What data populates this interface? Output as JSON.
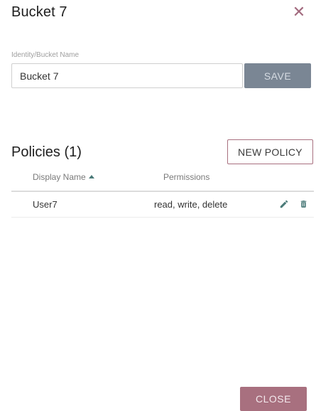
{
  "dialog": {
    "title": "Bucket 7",
    "close_icon": "close-icon",
    "close_glyph": "✕"
  },
  "form": {
    "label": "Identity/Bucket Name",
    "name_value": "Bucket 7",
    "save_label": "SAVE"
  },
  "policies": {
    "title": "Policies (1)",
    "new_policy_label": "NEW POLICY",
    "columns": [
      "Display Name",
      "Permissions"
    ],
    "sort_icon": "sort-ascending-icon",
    "rows": [
      {
        "display_name": "User7",
        "permissions": "read, write, delete",
        "edit_icon": "pencil-icon",
        "delete_icon": "trash-icon"
      }
    ]
  },
  "footer": {
    "close_label": "CLOSE"
  },
  "colors": {
    "accent": "#a8707f",
    "save_disabled": "#7a8694",
    "sort_arrow": "#4a7a78",
    "icon": "#4a7a78"
  }
}
